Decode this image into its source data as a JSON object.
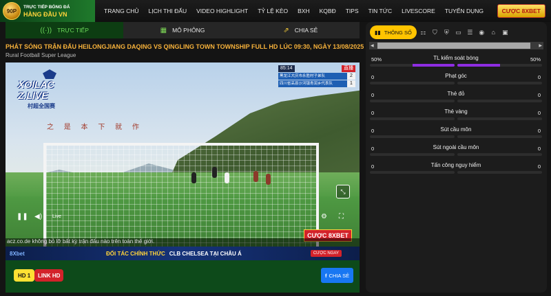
{
  "header": {
    "logo_line1": "TRỰC TIẾP BÓNG ĐÁ",
    "logo_line2": "HÀNG ĐẦU VN",
    "logo_badge": "90P",
    "nav": [
      "TRANG CHỦ",
      "LỊCH THI ĐẤU",
      "VIDEO HIGHLIGHT",
      "TỶ LỆ KÈO",
      "BXH",
      "KQBĐ",
      "TIPS",
      "TIN TỨC",
      "LIVESCORE",
      "TUYỂN DỤNG"
    ],
    "bet_button": "CƯỢC 8XBET"
  },
  "tabs": {
    "live": "TRỰC TIẾP",
    "simulation": "MÔ PHỎNG",
    "share": "CHIA SẺ"
  },
  "match": {
    "title": "PHÁT SÓNG TRẬN ĐẤU HEILONGJIANG DAQING VS QINGLING TOWN TOWNSHIP FULL HD LÚC 09:30, NGÀY 13/08/2025",
    "league": "Rural Football Super League"
  },
  "video": {
    "watermark": "XOILAC Z.LIVE",
    "watermark_sub": "村超全国赛",
    "clock": "85:14",
    "live_tag": "直播",
    "teams": [
      {
        "name": "黑龙江大庆市永胜村子弟队",
        "score": "2"
      },
      {
        "name": "四川省高县沙河镇青润乡代表队",
        "score": "1"
      }
    ],
    "banner": "之 是 本 下 就 作",
    "live_label": "Live",
    "cuoc_badge": "CƯỢC 8XBET",
    "ticker": "acz.co.de không bỏ lỡ bất kỳ trận đấu nào trên toàn thế giới.",
    "ad_brand": "8Xbet",
    "ad_text": "ĐỐI TÁC CHÍNH THỨC",
    "ad_text2": "CLB CHELSEA TẠI CHÂU Á",
    "ad_button": "CƯỢC NGAY"
  },
  "bottom": {
    "hd1": "HD 1",
    "link_hd": "LINK HD",
    "share": "CHIA SẺ"
  },
  "stats": {
    "tab_label": "THÔNG SỐ",
    "icons": [
      "lineup-icon",
      "shirt-icon",
      "jersey-icon",
      "chat-icon",
      "list-icon",
      "live-icon",
      "stadium-icon",
      "chart-icon"
    ],
    "rows": [
      {
        "label": "TL kiểm soát bóng",
        "home": "50%",
        "away": "50%",
        "home_value": 50,
        "away_value": 50
      },
      {
        "label": "Phạt góc",
        "home": "0",
        "away": "0",
        "home_value": 0,
        "away_value": 0
      },
      {
        "label": "Thẻ đỏ",
        "home": "0",
        "away": "0",
        "home_value": 0,
        "away_value": 0
      },
      {
        "label": "Thẻ vàng",
        "home": "0",
        "away": "0",
        "home_value": 0,
        "away_value": 0
      },
      {
        "label": "Sút cầu môn",
        "home": "0",
        "away": "0",
        "home_value": 0,
        "away_value": 0
      },
      {
        "label": "Sút ngoài cầu môn",
        "home": "0",
        "away": "0",
        "home_value": 0,
        "away_value": 0
      },
      {
        "label": "Tấn công nguy hiểm",
        "home": "0",
        "away": "0",
        "home_value": 0,
        "away_value": 0
      }
    ]
  },
  "colors": {
    "accent_yellow": "#ffc400",
    "stat_fill": "#8e2de2",
    "live_green": "#6cdb5a",
    "title_orange": "#f7b23b"
  }
}
